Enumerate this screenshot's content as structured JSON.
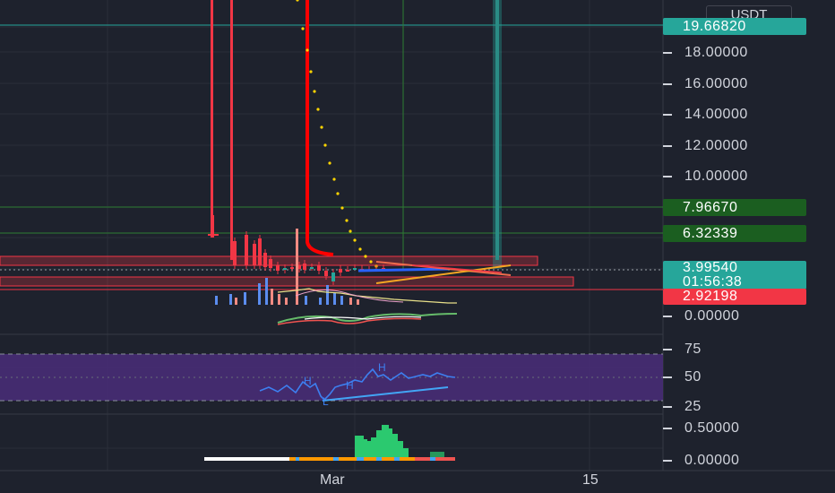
{
  "currency": "USDT",
  "price_axis": [
    "18.00000",
    "16.00000",
    "14.00000",
    "12.00000",
    "10.00000"
  ],
  "volume_axis": [
    "0.00000"
  ],
  "rsi_axis": [
    "75",
    "50",
    "25"
  ],
  "osc_axis": [
    "0.50000",
    "0.00000"
  ],
  "badges": {
    "top_line": "19.66820",
    "level_green": "7.96670",
    "level_green_2": "6.32339",
    "last_price": "3.99540",
    "countdown": "01:56:38",
    "low_level": "2.92198"
  },
  "pattern_labels": [
    "H",
    "H",
    "H",
    "L"
  ],
  "time_axis": [
    "Mar",
    "15"
  ],
  "colors": {
    "background": "#1e222d",
    "last_price": "#26a69a",
    "low_level": "#f23645",
    "green_level": "#1b5e20",
    "rsi_band": "#4a2d7a",
    "sar": "#ffd500",
    "trend_red": "#ff0000"
  }
}
